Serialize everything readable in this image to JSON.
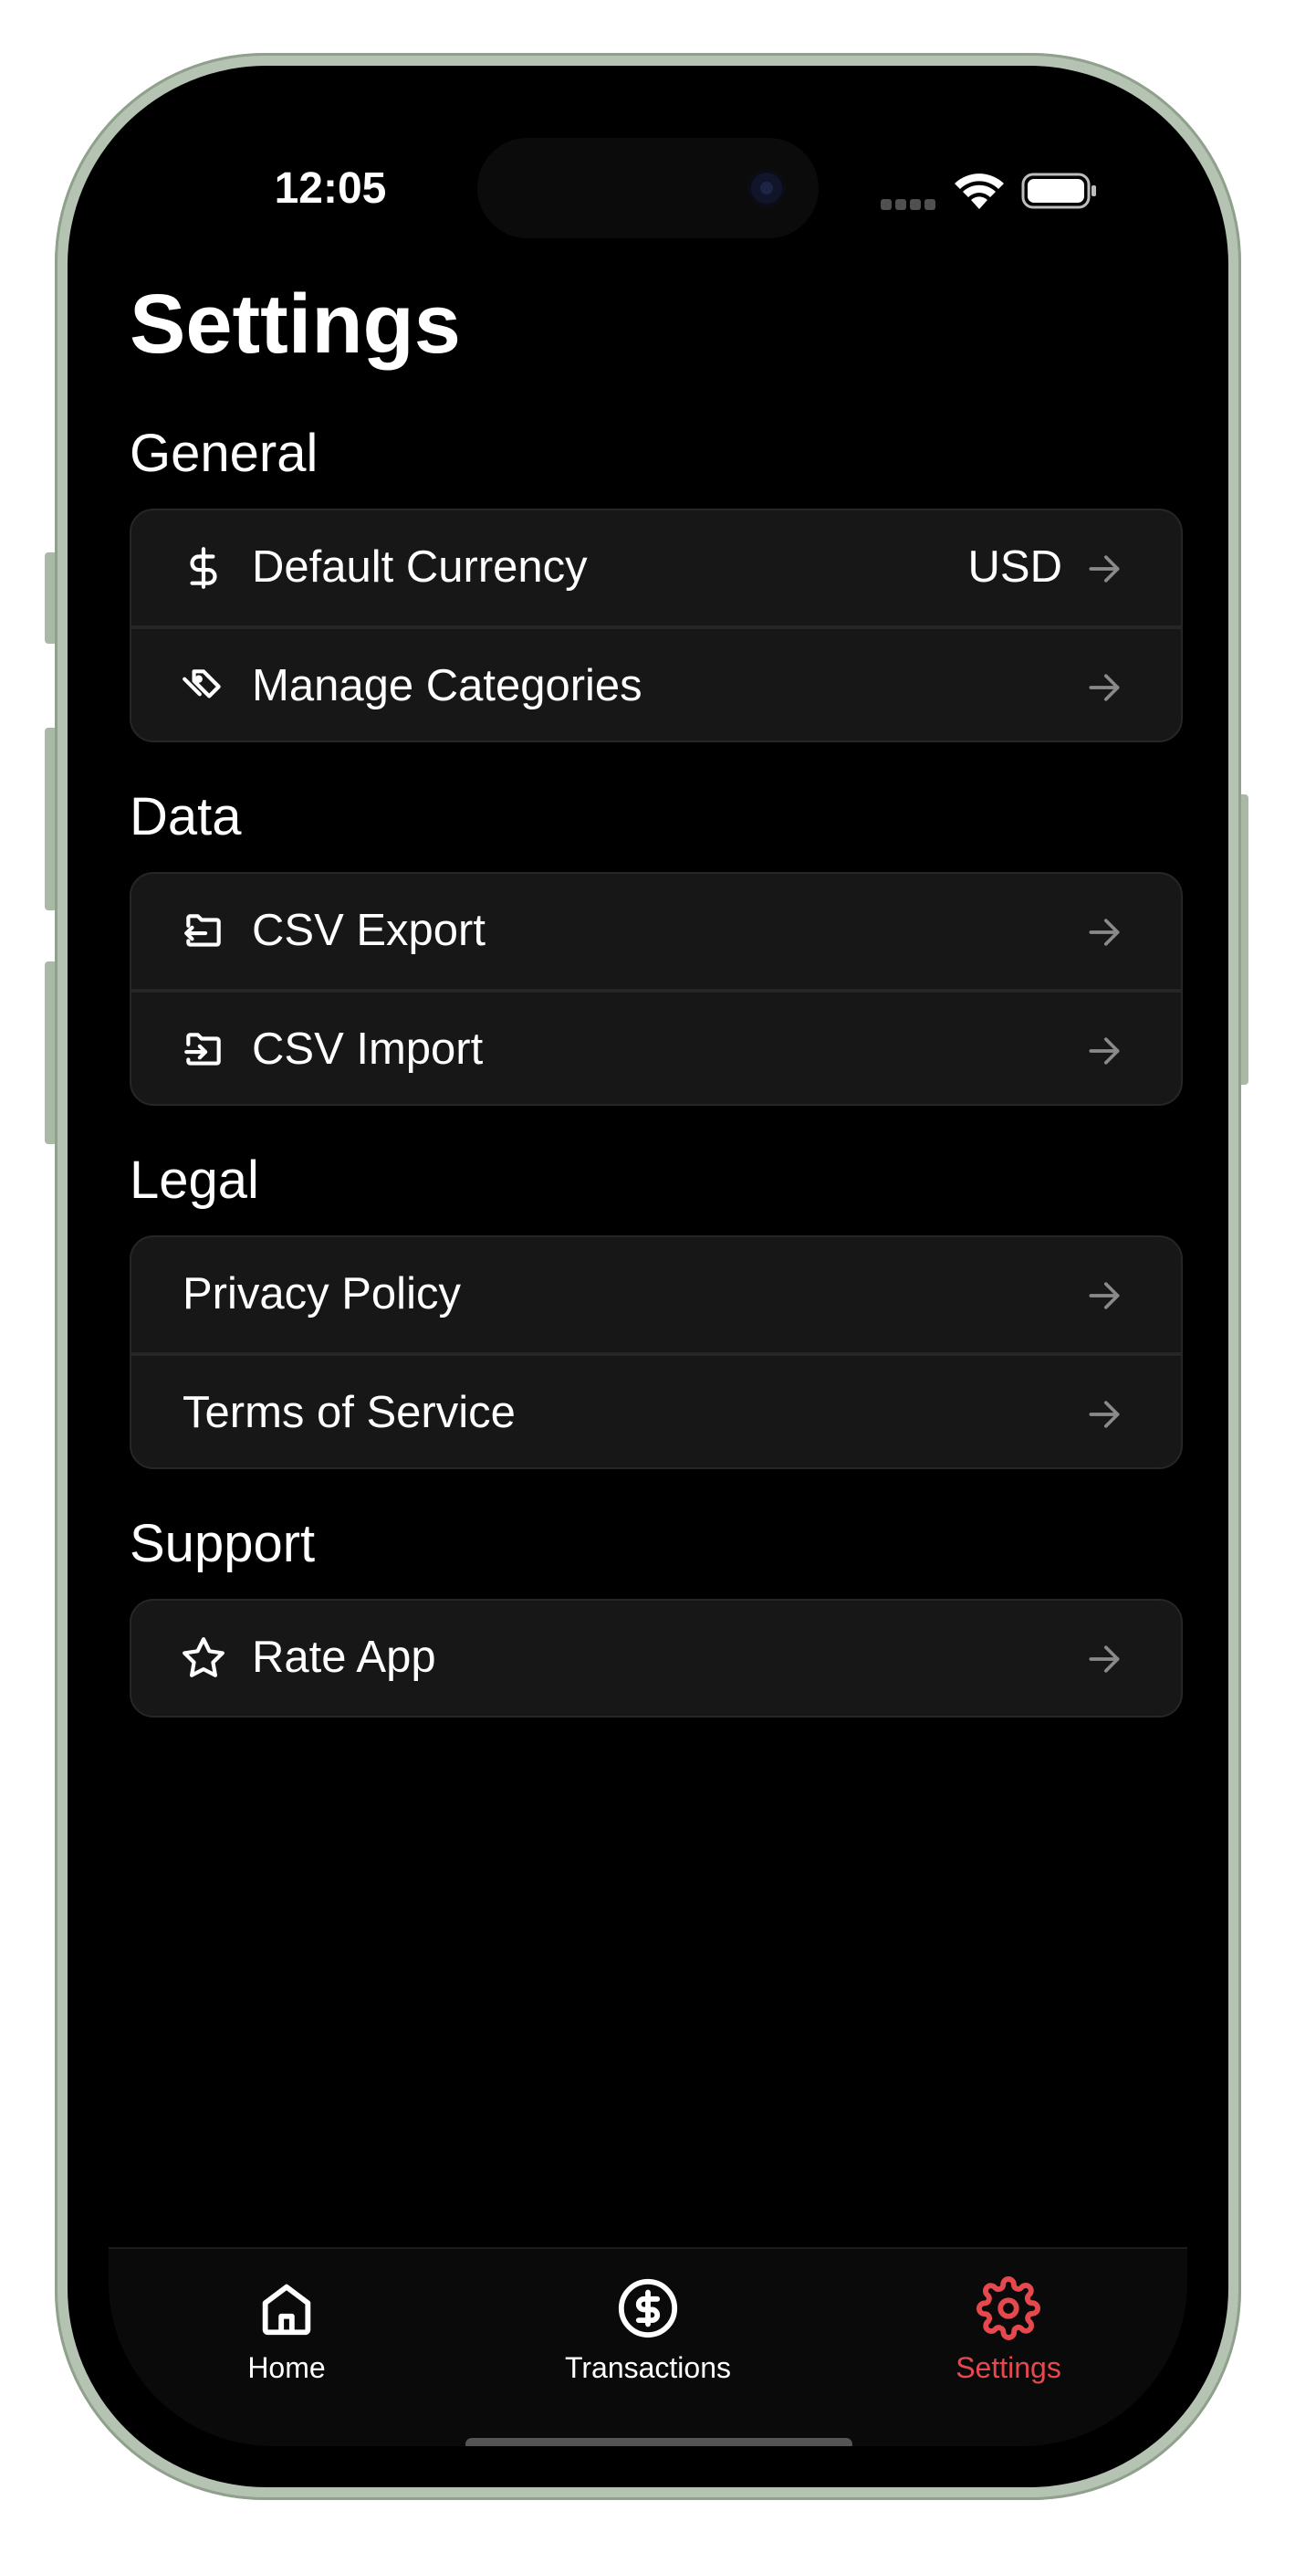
{
  "status_bar": {
    "time": "12:05"
  },
  "page": {
    "title": "Settings"
  },
  "sections": [
    {
      "title": "General",
      "rows": [
        {
          "icon": "dollar-icon",
          "label": "Default Currency",
          "value": "USD"
        },
        {
          "icon": "tag-icon",
          "label": "Manage Categories",
          "value": ""
        }
      ]
    },
    {
      "title": "Data",
      "rows": [
        {
          "icon": "folder-export-icon",
          "label": "CSV Export",
          "value": ""
        },
        {
          "icon": "folder-import-icon",
          "label": "CSV Import",
          "value": ""
        }
      ]
    },
    {
      "title": "Legal",
      "rows": [
        {
          "icon": "",
          "label": "Privacy Policy",
          "value": ""
        },
        {
          "icon": "",
          "label": "Terms of Service",
          "value": ""
        }
      ]
    },
    {
      "title": "Support",
      "rows": [
        {
          "icon": "star-icon",
          "label": "Rate App",
          "value": ""
        }
      ]
    }
  ],
  "tab_bar": {
    "tabs": [
      {
        "label": "Home",
        "icon": "home-icon",
        "active": false
      },
      {
        "label": "Transactions",
        "icon": "dollar-circle-icon",
        "active": false
      },
      {
        "label": "Settings",
        "icon": "gear-icon",
        "active": true
      }
    ]
  },
  "colors": {
    "background": "#000000",
    "card": "#171717",
    "divider": "#262626",
    "accent": "#e5484d",
    "arrow": "#8a8a8a",
    "frame": "#b5c4b2"
  }
}
